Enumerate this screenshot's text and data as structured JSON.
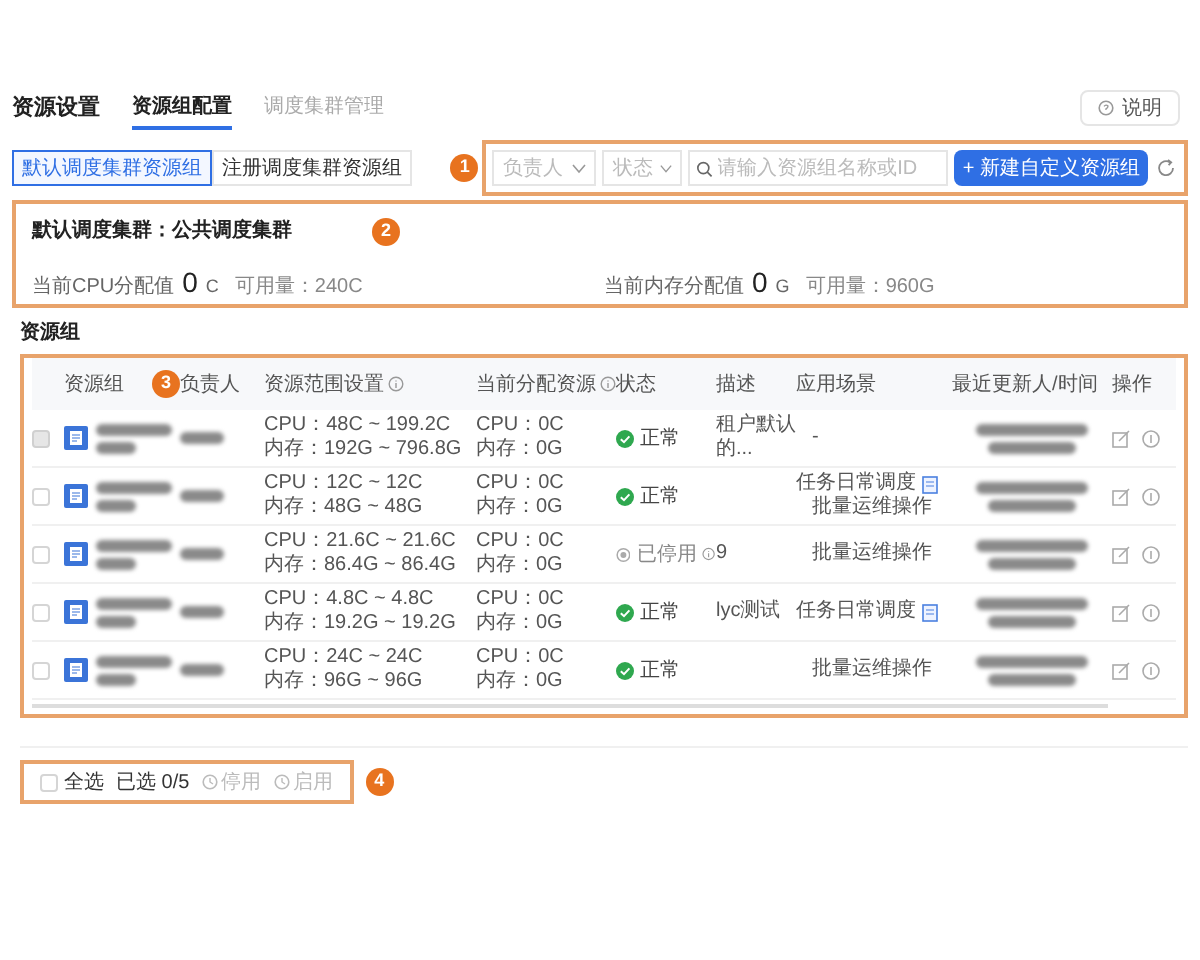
{
  "page": {
    "title": "资源设置",
    "help_button": "说明"
  },
  "tabs": [
    {
      "label": "资源组配置",
      "selected": true
    },
    {
      "label": "调度集群管理",
      "selected": false
    }
  ],
  "sub_tabs": [
    {
      "label": "默认调度集群资源组",
      "selected": true
    },
    {
      "label": "注册调度集群资源组",
      "selected": false
    }
  ],
  "filters": {
    "owner_select": {
      "placeholder": "负责人"
    },
    "status_select": {
      "placeholder": "状态"
    },
    "search": {
      "placeholder": "请输入资源组名称或ID"
    },
    "create_button": "+ 新建自定义资源组"
  },
  "cluster_card": {
    "title": "默认调度集群：公共调度集群",
    "cpu": {
      "label": "当前CPU分配值",
      "value": "0",
      "unit": "C",
      "available": "可用量：240C"
    },
    "memory": {
      "label": "当前内存分配值",
      "value": "0",
      "unit": "G",
      "available": "可用量：960G"
    }
  },
  "section_title": "资源组",
  "table": {
    "columns": [
      "资源组",
      "负责人",
      "资源范围设置",
      "当前分配资源",
      "状态",
      "描述",
      "应用场景",
      "最近更新人/时间",
      "操作"
    ],
    "rows": [
      {
        "checked": false,
        "disabled": true,
        "range": [
          "CPU：48C ~ 199.2C",
          "内存：192G ~ 796.8G"
        ],
        "allocated": [
          "CPU：0C",
          "内存：0G"
        ],
        "status": {
          "kind": "normal",
          "text": "正常"
        },
        "description": "租户默认的...",
        "scenarios": [
          {
            "text": "-",
            "doc_link": false
          }
        ]
      },
      {
        "checked": false,
        "disabled": false,
        "range": [
          "CPU：12C ~ 12C",
          "内存：48G ~ 48G"
        ],
        "allocated": [
          "CPU：0C",
          "内存：0G"
        ],
        "status": {
          "kind": "normal",
          "text": "正常"
        },
        "description": "",
        "scenarios": [
          {
            "text": "任务日常调度",
            "doc_link": true
          },
          {
            "text": "批量运维操作",
            "doc_link": false
          }
        ]
      },
      {
        "checked": false,
        "disabled": false,
        "range": [
          "CPU：21.6C ~ 21.6C",
          "内存：86.4G ~ 86.4G"
        ],
        "allocated": [
          "CPU：0C",
          "内存：0G"
        ],
        "status": {
          "kind": "stopped",
          "text": "已停用"
        },
        "description": "9",
        "scenarios": [
          {
            "text": "批量运维操作",
            "doc_link": false
          }
        ]
      },
      {
        "checked": false,
        "disabled": false,
        "range": [
          "CPU：4.8C ~ 4.8C",
          "内存：19.2G ~ 19.2G"
        ],
        "allocated": [
          "CPU：0C",
          "内存：0G"
        ],
        "status": {
          "kind": "normal",
          "text": "正常"
        },
        "description": "lyc测试",
        "scenarios": [
          {
            "text": "任务日常调度",
            "doc_link": true
          }
        ]
      },
      {
        "checked": false,
        "disabled": false,
        "range": [
          "CPU：24C ~ 24C",
          "内存：96G ~ 96G"
        ],
        "allocated": [
          "CPU：0C",
          "内存：0G"
        ],
        "status": {
          "kind": "normal",
          "text": "正常"
        },
        "description": "",
        "scenarios": [
          {
            "text": "批量运维操作",
            "doc_link": false
          }
        ]
      }
    ]
  },
  "footer": {
    "select_all": {
      "label": "全选",
      "checked": false
    },
    "selected_count": "已选 0/5",
    "actions": [
      {
        "label": "停用",
        "disabled": true
      },
      {
        "label": "启用",
        "disabled": true
      }
    ]
  },
  "annotations": [
    {
      "label": "1"
    },
    {
      "label": "2"
    },
    {
      "label": "3"
    },
    {
      "label": "4"
    }
  ]
}
